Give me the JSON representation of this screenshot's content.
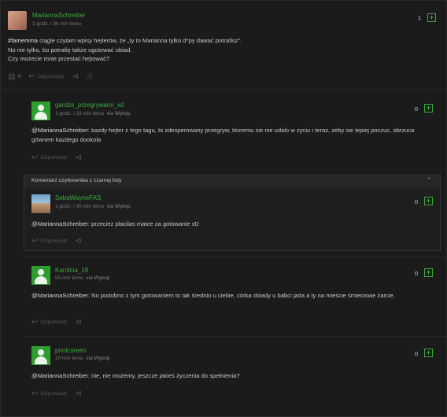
{
  "main": {
    "author": "MariannaSchreiber",
    "meta": "1 godz. i 36 min temu",
    "tag": "#famemma",
    "lines": [
      " ciągle czytam wpisy hejterów, że „ty to Marianna tylko d*py dawać potrafisz\".",
      "No nie tylko, bo potrafię także ugotować obiad.",
      "Czy możecie mnie przestać hejtować?"
    ],
    "votes": "1",
    "comment_count": "4",
    "reply_label": "Odpowiedz"
  },
  "comments": [
    {
      "author": "gardze_przegrywami_xd",
      "time": "1 godz. i 33 min temu",
      "via": "via Wykop",
      "mention": "@MariannaSchreiber",
      "text": ": kazdy hejter z tego tagu, to zdesperowany przegryw, ktoremu sie nie udalo w zyciu i teraz, zeby sie lepiej poczuc, obrzuca g0wnem kazdego dookola",
      "votes": "0",
      "reply_label": "Odpowiedz"
    },
    {
      "author": "SebaWayneFAS",
      "time": "1 godz. i 30 min temu",
      "via": "via Wykop",
      "mention": "@MariannaSchreiber",
      "text": ": przeciez placilas matce za gotowanie xD",
      "votes": "0",
      "reply_label": "Odpowiedz"
    },
    {
      "author": "Karolcia_18",
      "time": "55 min temu",
      "via": "via Wykop",
      "mention": "@MariannaSchreiber",
      "text": ": No podobno z tym gotowaniem to tak średnio u ciebie, córka obiady u babci jada a ty na mieście śmieciowe żarcie.",
      "votes": "0",
      "reply_label": "Odpowiedz"
    },
    {
      "author": "printcsreen",
      "time": "10 min temu",
      "via": "via Wykop",
      "mention": "@MariannaSchreiber",
      "text": ": nie, nie możemy, jeszcze jakieś życzenia do spełnienia?",
      "votes": "0",
      "reply_label": "Odpowiedz"
    }
  ],
  "blacklist_label": "Komentarz użytkownika z czarnej listy",
  "colors": {
    "accent": "#3ca93c",
    "background": "#1b1b1b"
  }
}
